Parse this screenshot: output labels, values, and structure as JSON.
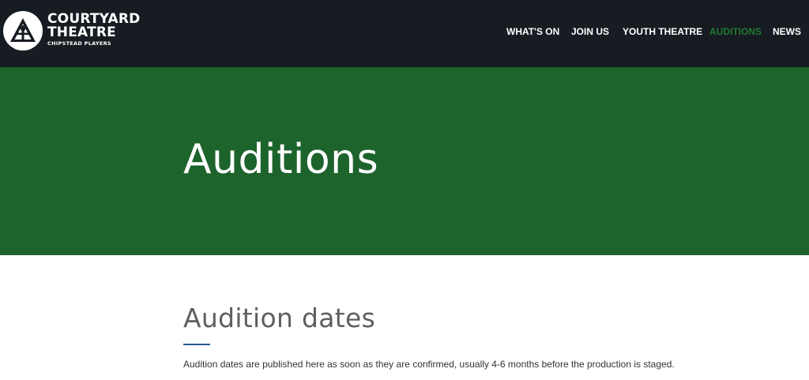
{
  "brand": {
    "line1": "COURTYARD",
    "line2": "THEATRE",
    "line3": "CHIPSTEAD PLAYERS",
    "logo_icon": "theatre-logo-icon"
  },
  "nav": {
    "items": [
      {
        "label": "WHAT'S ON",
        "active": false
      },
      {
        "label": "JOIN US",
        "active": false
      },
      {
        "label": "YOUTH THEATRE",
        "active": false
      },
      {
        "label": "AUDITIONS",
        "active": true
      },
      {
        "label": "NEWS",
        "active": false
      }
    ]
  },
  "hero": {
    "title": "Auditions"
  },
  "section": {
    "heading": "Audition dates",
    "body": "Audition dates are published here as soon as they are confirmed, usually 4-6 months before the production is staged."
  },
  "colors": {
    "header_bg": "#171b22",
    "hero_bg": "#1d632c",
    "nav_active": "#1e7a31",
    "heading_rule": "#2d5a8e"
  }
}
